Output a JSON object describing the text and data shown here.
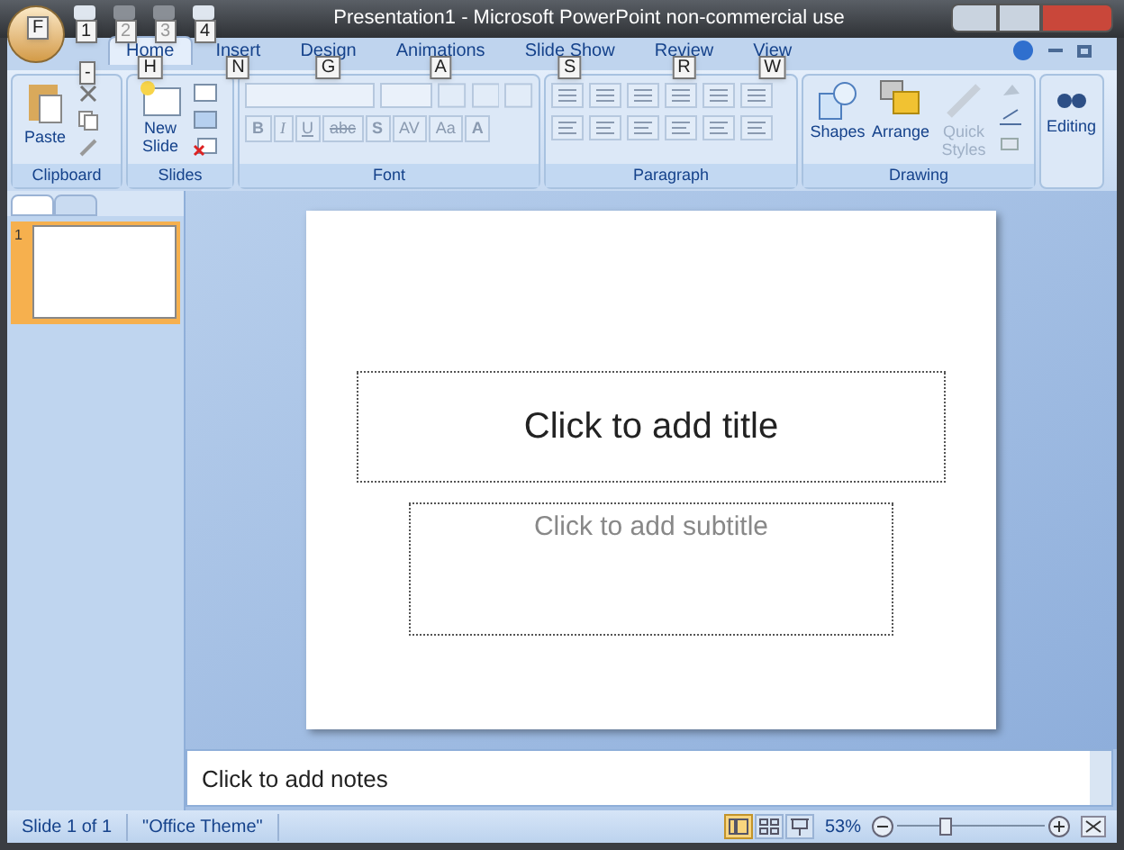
{
  "window": {
    "title": "Presentation1 - Microsoft PowerPoint non-commercial use"
  },
  "office_button": {
    "keytip": "F"
  },
  "quick_access": [
    {
      "keytip": "1",
      "disabled": false
    },
    {
      "keytip": "2",
      "disabled": true
    },
    {
      "keytip": "3",
      "disabled": true
    },
    {
      "keytip": "4",
      "disabled": false
    }
  ],
  "quick_access_menu": {
    "keytip": "-"
  },
  "tabs": [
    {
      "label": "Home",
      "keytip": "H",
      "selected": true
    },
    {
      "label": "Insert",
      "keytip": "N",
      "selected": false
    },
    {
      "label": "Design",
      "keytip": "G",
      "selected": false
    },
    {
      "label": "Animations",
      "keytip": "A",
      "selected": false
    },
    {
      "label": "Slide Show",
      "keytip": "S",
      "selected": false
    },
    {
      "label": "Review",
      "keytip": "R",
      "selected": false
    },
    {
      "label": "View",
      "keytip": "W",
      "selected": false
    }
  ],
  "ribbon": {
    "clipboard": {
      "label": "Clipboard",
      "paste": "Paste"
    },
    "slides": {
      "label": "Slides",
      "new_slide": [
        "New",
        "Slide"
      ]
    },
    "font": {
      "label": "Font",
      "buttons": [
        "B",
        "I",
        "U",
        "abc",
        "S",
        "AV",
        "Aa",
        "A"
      ]
    },
    "paragraph": {
      "label": "Paragraph"
    },
    "drawing": {
      "label": "Drawing",
      "buttons": [
        {
          "label": "Shapes",
          "disabled": false
        },
        {
          "label": "Arrange",
          "disabled": false
        },
        {
          "label": "Quick Styles",
          "disabled": true
        }
      ]
    },
    "editing": {
      "label": "Editing"
    }
  },
  "slides_pane": {
    "thumbnails": [
      {
        "number": "1",
        "selected": true
      }
    ]
  },
  "slide": {
    "title_placeholder": "Click to add title",
    "subtitle_placeholder": "Click to add subtitle"
  },
  "notes": {
    "placeholder": "Click to add notes"
  },
  "status_bar": {
    "slide": "Slide 1 of 1",
    "theme": "\"Office Theme\"",
    "views": [
      {
        "kind": "normal",
        "selected": true
      },
      {
        "kind": "sorter",
        "selected": false
      },
      {
        "kind": "show",
        "selected": false
      }
    ],
    "zoom": "53%",
    "zoom_slider": {
      "level": 0.33
    }
  }
}
